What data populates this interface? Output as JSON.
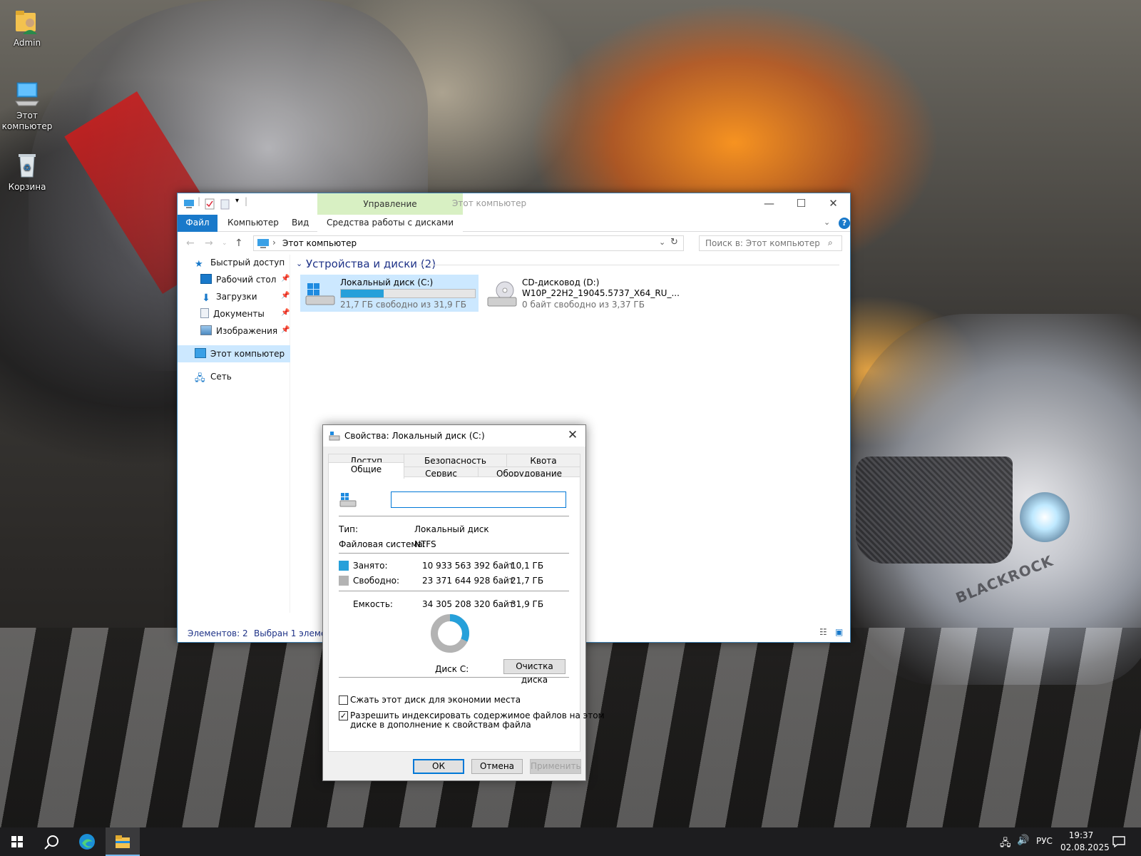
{
  "desktop": {
    "icons": [
      {
        "label": "Admin",
        "icon": "user-folder-icon"
      },
      {
        "label": "Этот компьютер",
        "icon": "computer-icon"
      },
      {
        "label": "Корзина",
        "icon": "recycle-bin-icon"
      }
    ],
    "wallpaper_text": "BLACKROCK"
  },
  "explorer": {
    "ribbon_context_header": "Управление",
    "window_title": "Этот компьютер",
    "tabs": {
      "file": "Файл",
      "computer": "Компьютер",
      "view": "Вид",
      "disk_tools": "Средства работы с дисками"
    },
    "address": "Этот компьютер",
    "search_placeholder": "Поиск в: Этот компьютер",
    "nav": {
      "quick_access": "Быстрый доступ",
      "desktop": "Рабочий стол",
      "downloads": "Загрузки",
      "documents": "Документы",
      "pictures": "Изображения",
      "this_pc": "Этот компьютер",
      "network": "Сеть"
    },
    "group_title": "Устройства и диски (2)",
    "drives": [
      {
        "name": "Локальный диск (C:)",
        "subtitle": "",
        "free_text": "21,7 ГБ свободно из 31,9 ГБ",
        "used_fraction": 0.32
      },
      {
        "name": "CD-дисковод (D:)",
        "subtitle": "W10P_22H2_19045.5737_X64_RU_...",
        "free_text": "0 байт свободно из 3,37 ГБ"
      }
    ],
    "status": {
      "items": "Элементов: 2",
      "selected": "Выбран 1 элемент"
    }
  },
  "dialog": {
    "title": "Свойства: Локальный диск (C:)",
    "tabs_row1": [
      "Доступ",
      "Безопасность",
      "Квота"
    ],
    "tabs_row2": [
      "Общие",
      "Сервис",
      "Оборудование"
    ],
    "name_value": "",
    "type_label": "Тип:",
    "type_value": "Локальный диск",
    "fs_label": "Файловая система:",
    "fs_value": "NTFS",
    "used_label": "Занято:",
    "used_bytes": "10 933 563 392 байт",
    "used_gb": "10,1 ГБ",
    "free_label": "Свободно:",
    "free_bytes": "23 371 644 928 байт",
    "free_gb": "21,7 ГБ",
    "capacity_label": "Емкость:",
    "capacity_bytes": "34 305 208 320 байт",
    "capacity_gb": "31,9 ГБ",
    "used_fraction": 0.32,
    "disk_label": "Диск C:",
    "cleanup_button": "Очистка диска",
    "compress_label": "Сжать этот диск для экономии места",
    "compress_checked": false,
    "index_label_line1": "Разрешить индексировать содержимое файлов на этом",
    "index_label_line2": "диске в дополнение к свойствам файла",
    "index_checked": true,
    "ok": "ОК",
    "cancel": "Отмена",
    "apply": "Применить",
    "colors": {
      "used": "#26a0da",
      "free": "#b3b3b3"
    }
  },
  "taskbar": {
    "language": "РУС",
    "time": "19:37",
    "date": "02.08.2025"
  }
}
